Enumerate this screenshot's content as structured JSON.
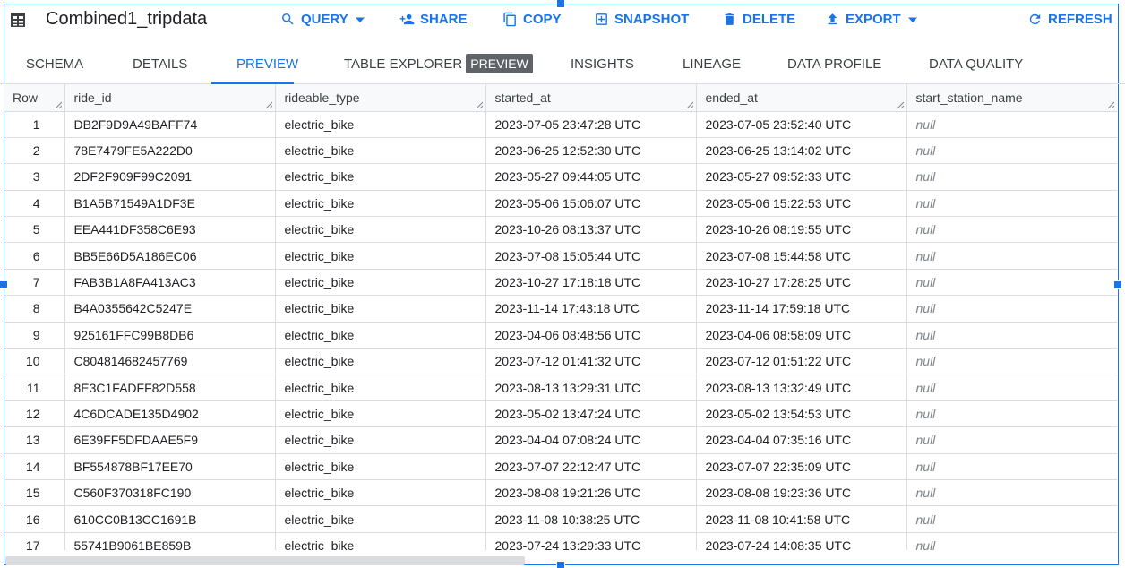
{
  "header": {
    "title": "Combined1_tripdata",
    "icon": "table-icon"
  },
  "toolbar": {
    "query": "QUERY",
    "share": "SHARE",
    "copy": "COPY",
    "snapshot": "SNAPSHOT",
    "delete": "DELETE",
    "export": "EXPORT",
    "refresh": "REFRESH"
  },
  "tabs": {
    "schema": "SCHEMA",
    "details": "DETAILS",
    "preview": "PREVIEW",
    "table_explorer": "TABLE EXPLORER",
    "table_explorer_badge": "PREVIEW",
    "insights": "INSIGHTS",
    "lineage": "LINEAGE",
    "data_profile": "DATA PROFILE",
    "data_quality": "DATA QUALITY",
    "active": "PREVIEW"
  },
  "table": {
    "columns": [
      "Row",
      "ride_id",
      "rideable_type",
      "started_at",
      "ended_at",
      "start_station_name"
    ],
    "rows": [
      [
        "1",
        "DB2F9D9A49BAFF74",
        "electric_bike",
        "2023-07-05 23:47:28 UTC",
        "2023-07-05 23:52:40 UTC",
        "null"
      ],
      [
        "2",
        "78E7479FE5A222D0",
        "electric_bike",
        "2023-06-25 12:52:30 UTC",
        "2023-06-25 13:14:02 UTC",
        "null"
      ],
      [
        "3",
        "2DF2F909F99C2091",
        "electric_bike",
        "2023-05-27 09:44:05 UTC",
        "2023-05-27 09:52:33 UTC",
        "null"
      ],
      [
        "4",
        "B1A5B71549A1DF3E",
        "electric_bike",
        "2023-05-06 15:06:07 UTC",
        "2023-05-06 15:22:53 UTC",
        "null"
      ],
      [
        "5",
        "EEA441DF358C6E93",
        "electric_bike",
        "2023-10-26 08:13:37 UTC",
        "2023-10-26 08:19:55 UTC",
        "null"
      ],
      [
        "6",
        "BB5E66D5A186EC06",
        "electric_bike",
        "2023-07-08 15:05:44 UTC",
        "2023-07-08 15:44:58 UTC",
        "null"
      ],
      [
        "7",
        "FAB3B1A8FA413AC3",
        "electric_bike",
        "2023-10-27 17:18:18 UTC",
        "2023-10-27 17:28:25 UTC",
        "null"
      ],
      [
        "8",
        "B4A0355642C5247E",
        "electric_bike",
        "2023-11-14 17:43:18 UTC",
        "2023-11-14 17:59:18 UTC",
        "null"
      ],
      [
        "9",
        "925161FFC99B8DB6",
        "electric_bike",
        "2023-04-06 08:48:56 UTC",
        "2023-04-06 08:58:09 UTC",
        "null"
      ],
      [
        "10",
        "C804814682457769",
        "electric_bike",
        "2023-07-12 01:41:32 UTC",
        "2023-07-12 01:51:22 UTC",
        "null"
      ],
      [
        "11",
        "8E3C1FADFF82D558",
        "electric_bike",
        "2023-08-13 13:29:31 UTC",
        "2023-08-13 13:32:49 UTC",
        "null"
      ],
      [
        "12",
        "4C6DCADE135D4902",
        "electric_bike",
        "2023-05-02 13:47:24 UTC",
        "2023-05-02 13:54:53 UTC",
        "null"
      ],
      [
        "13",
        "6E39FF5DFDAAE5F9",
        "electric_bike",
        "2023-04-04 07:08:24 UTC",
        "2023-04-04 07:35:16 UTC",
        "null"
      ],
      [
        "14",
        "BF554878BF17EE70",
        "electric_bike",
        "2023-07-07 22:12:47 UTC",
        "2023-07-07 22:35:09 UTC",
        "null"
      ],
      [
        "15",
        "C560F370318FC190",
        "electric_bike",
        "2023-08-08 19:21:26 UTC",
        "2023-08-08 19:23:36 UTC",
        "null"
      ],
      [
        "16",
        "610CC0B13CC1691B",
        "electric_bike",
        "2023-11-08 10:38:25 UTC",
        "2023-11-08 10:41:58 UTC",
        "null"
      ],
      [
        "17",
        "55741B9061BE859B",
        "electric_bike",
        "2023-07-24 13:29:33 UTC",
        "2023-07-24 14:08:35 UTC",
        "null"
      ]
    ]
  },
  "colors": {
    "accent": "#1a73e8",
    "text": "#202124",
    "null_text": "#80868b",
    "border": "#dadce0"
  }
}
